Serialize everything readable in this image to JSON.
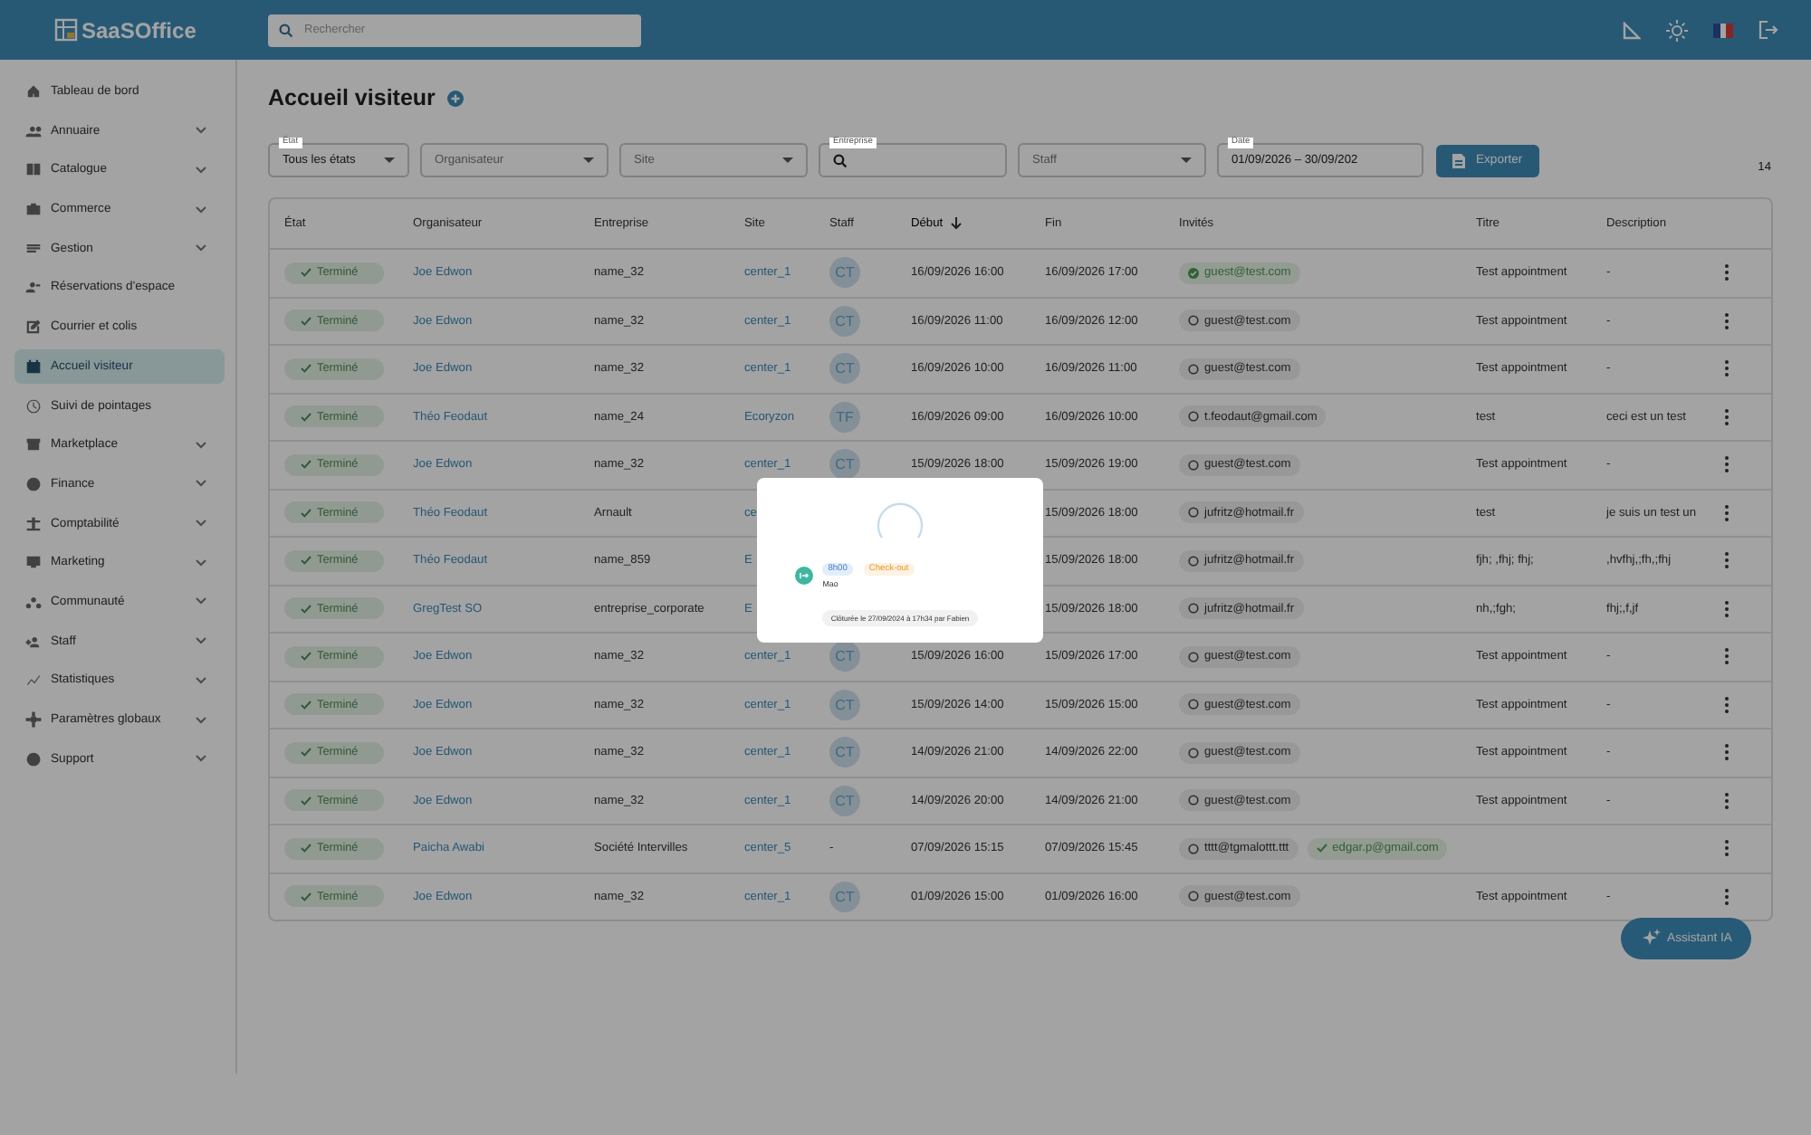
{
  "header": {
    "logo": "SaaSOffice",
    "search": {
      "placeholder": "Rechercher"
    }
  },
  "sidebar": {
    "items": [
      {
        "label": "Tableau de bord",
        "expandable": false,
        "selected": false
      },
      {
        "label": "Annuaire",
        "expandable": true,
        "selected": false
      },
      {
        "label": "Catalogue",
        "expandable": true,
        "selected": false
      },
      {
        "label": "Commerce",
        "expandable": true,
        "selected": false
      },
      {
        "label": "Gestion",
        "expandable": true,
        "selected": false
      },
      {
        "label": "Réservations d'espace",
        "expandable": false,
        "selected": false
      },
      {
        "label": "Courrier et colis",
        "expandable": false,
        "selected": false
      },
      {
        "label": "Accueil visiteur",
        "expandable": false,
        "selected": true
      },
      {
        "label": "Suivi de pointages",
        "expandable": false,
        "selected": false
      },
      {
        "label": "Marketplace",
        "expandable": true,
        "selected": false
      },
      {
        "label": "Finance",
        "expandable": true,
        "selected": false
      },
      {
        "label": "Comptabilité",
        "expandable": true,
        "selected": false
      },
      {
        "label": "Marketing",
        "expandable": true,
        "selected": false
      },
      {
        "label": "Communauté",
        "expandable": true,
        "selected": false
      },
      {
        "label": "Staff",
        "expandable": true,
        "selected": false
      },
      {
        "label": "Statistiques",
        "expandable": true,
        "selected": false
      },
      {
        "label": "Paramètres globaux",
        "expandable": true,
        "selected": false
      },
      {
        "label": "Support",
        "expandable": true,
        "selected": false
      }
    ]
  },
  "page": {
    "title": "Accueil visiteur",
    "count": "14"
  },
  "filters": [
    {
      "kind": "select",
      "label": "État",
      "value": "Tous les états"
    },
    {
      "kind": "select",
      "placeholder": "Organisateur"
    },
    {
      "kind": "select",
      "placeholder": "Site"
    },
    {
      "kind": "search",
      "label": "Entreprise"
    },
    {
      "kind": "select",
      "placeholder": "Staff"
    },
    {
      "kind": "text",
      "label": "Date",
      "value": "01/09/2026 – 30/09/202"
    }
  ],
  "export_button": "Exporter",
  "table": {
    "columns": [
      {
        "label": "État",
        "sorted": false
      },
      {
        "label": "Organisateur",
        "sorted": false
      },
      {
        "label": "Entreprise",
        "sorted": false
      },
      {
        "label": "Site",
        "sorted": false
      },
      {
        "label": "Staff",
        "sorted": false
      },
      {
        "label": "Début",
        "sorted": true
      },
      {
        "label": "Fin",
        "sorted": false
      },
      {
        "label": "Invités",
        "sorted": false
      },
      {
        "label": "Titre",
        "sorted": false
      },
      {
        "label": "Description",
        "sorted": false
      }
    ],
    "rows": [
      {
        "status": "Terminé",
        "organizer": "Joe Edwon",
        "company": "name_32",
        "site": "center_1",
        "staff": {
          "kind": "avatar",
          "text": "CT"
        },
        "start": "16/09/2026 16:00",
        "end": "16/09/2026 17:00",
        "guests": [
          {
            "email": "guest@test.com",
            "kind": "confirmed"
          }
        ],
        "title": "Test appointment",
        "description": "-"
      },
      {
        "status": "Terminé",
        "organizer": "Joe Edwon",
        "company": "name_32",
        "site": "center_1",
        "staff": {
          "kind": "avatar",
          "text": "CT"
        },
        "start": "16/09/2026 11:00",
        "end": "16/09/2026 12:00",
        "guests": [
          {
            "email": "guest@test.com",
            "kind": "pending"
          }
        ],
        "title": "Test appointment",
        "description": "-"
      },
      {
        "status": "Terminé",
        "organizer": "Joe Edwon",
        "company": "name_32",
        "site": "center_1",
        "staff": {
          "kind": "avatar",
          "text": "CT"
        },
        "start": "16/09/2026 10:00",
        "end": "16/09/2026 11:00",
        "guests": [
          {
            "email": "guest@test.com",
            "kind": "pending"
          }
        ],
        "title": "Test appointment",
        "description": "-"
      },
      {
        "status": "Terminé",
        "organizer": "Théo Feodaut",
        "company": "name_24",
        "site": "Ecoryzon",
        "staff": {
          "kind": "avatar",
          "text": "TF"
        },
        "start": "16/09/2026 09:00",
        "end": "16/09/2026 10:00",
        "guests": [
          {
            "email": "t.feodaut@gmail.com",
            "kind": "pending"
          }
        ],
        "title": "test",
        "description": "ceci est un test"
      },
      {
        "status": "Terminé",
        "organizer": "Joe Edwon",
        "company": "name_32",
        "site": "center_1",
        "staff": {
          "kind": "avatar",
          "text": "CT"
        },
        "start": "15/09/2026 18:00",
        "end": "15/09/2026 19:00",
        "guests": [
          {
            "email": "guest@test.com",
            "kind": "pending"
          }
        ],
        "title": "Test appointment",
        "description": "-"
      },
      {
        "status": "Terminé",
        "organizer": "Théo Feodaut",
        "company": "Arnault",
        "site": "ce",
        "end": "15/09/2026 18:00",
        "guests": [
          {
            "email": "jufritz@hotmail.fr",
            "kind": "pending"
          }
        ],
        "title": "test",
        "description": "je suis un test un"
      },
      {
        "status": "Terminé",
        "organizer": "Théo Feodaut",
        "company": "name_859",
        "site": "E",
        "end": "15/09/2026 18:00",
        "guests": [
          {
            "email": "jufritz@hotmail.fr",
            "kind": "pending"
          }
        ],
        "title": "fjh; ,fhj; fhj;",
        "description": ",hvfhj,;fh,;fhj"
      },
      {
        "status": "Terminé",
        "organizer": "GregTest SO",
        "company": "entreprise_corporate",
        "site": "E",
        "end": "15/09/2026 18:00",
        "guests": [
          {
            "email": "jufritz@hotmail.fr",
            "kind": "pending"
          }
        ],
        "title": "nh,;fgh;",
        "description": "fhj;,f,jf"
      },
      {
        "status": "Terminé",
        "organizer": "Joe Edwon",
        "company": "name_32",
        "site": "center_1",
        "staff": {
          "kind": "avatar",
          "text": "CT"
        },
        "start": "15/09/2026 16:00",
        "end": "15/09/2026 17:00",
        "guests": [
          {
            "email": "guest@test.com",
            "kind": "pending"
          }
        ],
        "title": "Test appointment",
        "description": "-"
      },
      {
        "status": "Terminé",
        "organizer": "Joe Edwon",
        "company": "name_32",
        "site": "center_1",
        "staff": {
          "kind": "avatar",
          "text": "CT"
        },
        "start": "15/09/2026 14:00",
        "end": "15/09/2026 15:00",
        "guests": [
          {
            "email": "guest@test.com",
            "kind": "pending"
          }
        ],
        "title": "Test appointment",
        "description": "-"
      },
      {
        "status": "Terminé",
        "organizer": "Joe Edwon",
        "company": "name_32",
        "site": "center_1",
        "staff": {
          "kind": "avatar",
          "text": "CT"
        },
        "start": "14/09/2026 21:00",
        "end": "14/09/2026 22:00",
        "guests": [
          {
            "email": "guest@test.com",
            "kind": "pending"
          }
        ],
        "title": "Test appointment",
        "description": "-"
      },
      {
        "status": "Terminé",
        "organizer": "Joe Edwon",
        "company": "name_32",
        "site": "center_1",
        "staff": {
          "kind": "avatar",
          "text": "CT"
        },
        "start": "14/09/2026 20:00",
        "end": "14/09/2026 21:00",
        "guests": [
          {
            "email": "guest@test.com",
            "kind": "pending"
          }
        ],
        "title": "Test appointment",
        "description": "-"
      },
      {
        "status": "Terminé",
        "organizer": "Paicha Awabi",
        "company": "Société Intervilles",
        "site": "center_5",
        "staff": {
          "kind": "none",
          "text": "-"
        },
        "start": "07/09/2026 15:15",
        "end": "07/09/2026 15:45",
        "guests": [
          {
            "email": "tttt@tgmalottt.ttt",
            "kind": "pending"
          },
          {
            "email": "edgar.p@gmail.com",
            "kind": "checked"
          }
        ]
      },
      {
        "status": "Terminé",
        "organizer": "Joe Edwon",
        "company": "name_32",
        "site": "center_1",
        "staff": {
          "kind": "avatar",
          "text": "CT"
        },
        "start": "01/09/2026 15:00",
        "end": "01/09/2026 16:00",
        "guests": [
          {
            "email": "guest@test.com",
            "kind": "pending"
          }
        ],
        "title": "Test appointment",
        "description": "-"
      }
    ]
  },
  "assistant_button": "Assistant IA",
  "modal": {
    "time": "8h00",
    "action": "Check-out",
    "person": "Mao",
    "note": "Clôturée le 27/09/2024 à 17h34 par Fabien"
  }
}
